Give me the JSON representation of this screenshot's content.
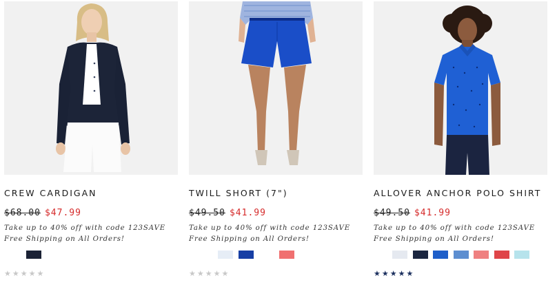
{
  "products": [
    {
      "name": "CREW CARDIGAN",
      "was_price": "$68.00",
      "sale_price": "$47.99",
      "promo_line1": "Take up to 40% off with code 123SAVE",
      "promo_line2": "Free Shipping on All Orders!",
      "swatches": [
        "#1b2235"
      ],
      "rating": 0
    },
    {
      "name": "TWILL SHORT (7\")",
      "was_price": "$49.50",
      "sale_price": "$41.99",
      "promo_line1": "Take up to 40% off with code 123SAVE",
      "promo_line2": "Free Shipping on All Orders!",
      "swatches": [
        "#e6edf6",
        "#173fa5",
        "#ffffff",
        "#f07070"
      ],
      "rating": 0
    },
    {
      "name": "ALLOVER ANCHOR POLO SHIRT",
      "was_price": "$49.50",
      "sale_price": "$41.99",
      "promo_line1": "Take up to 40% off with code 123SAVE",
      "promo_line2": "Free Shipping on All Orders!",
      "swatches": [
        "#e5e9f0",
        "#1b2640",
        "#1e5ec9",
        "#5d8ed0",
        "#ef8080",
        "#df4549",
        "#b6e3ec"
      ],
      "rating": 5
    }
  ],
  "colors": {
    "sale_price": "#d52a2a",
    "star_filled": "#1b2f5e",
    "star_empty": "#c8c8c8"
  }
}
